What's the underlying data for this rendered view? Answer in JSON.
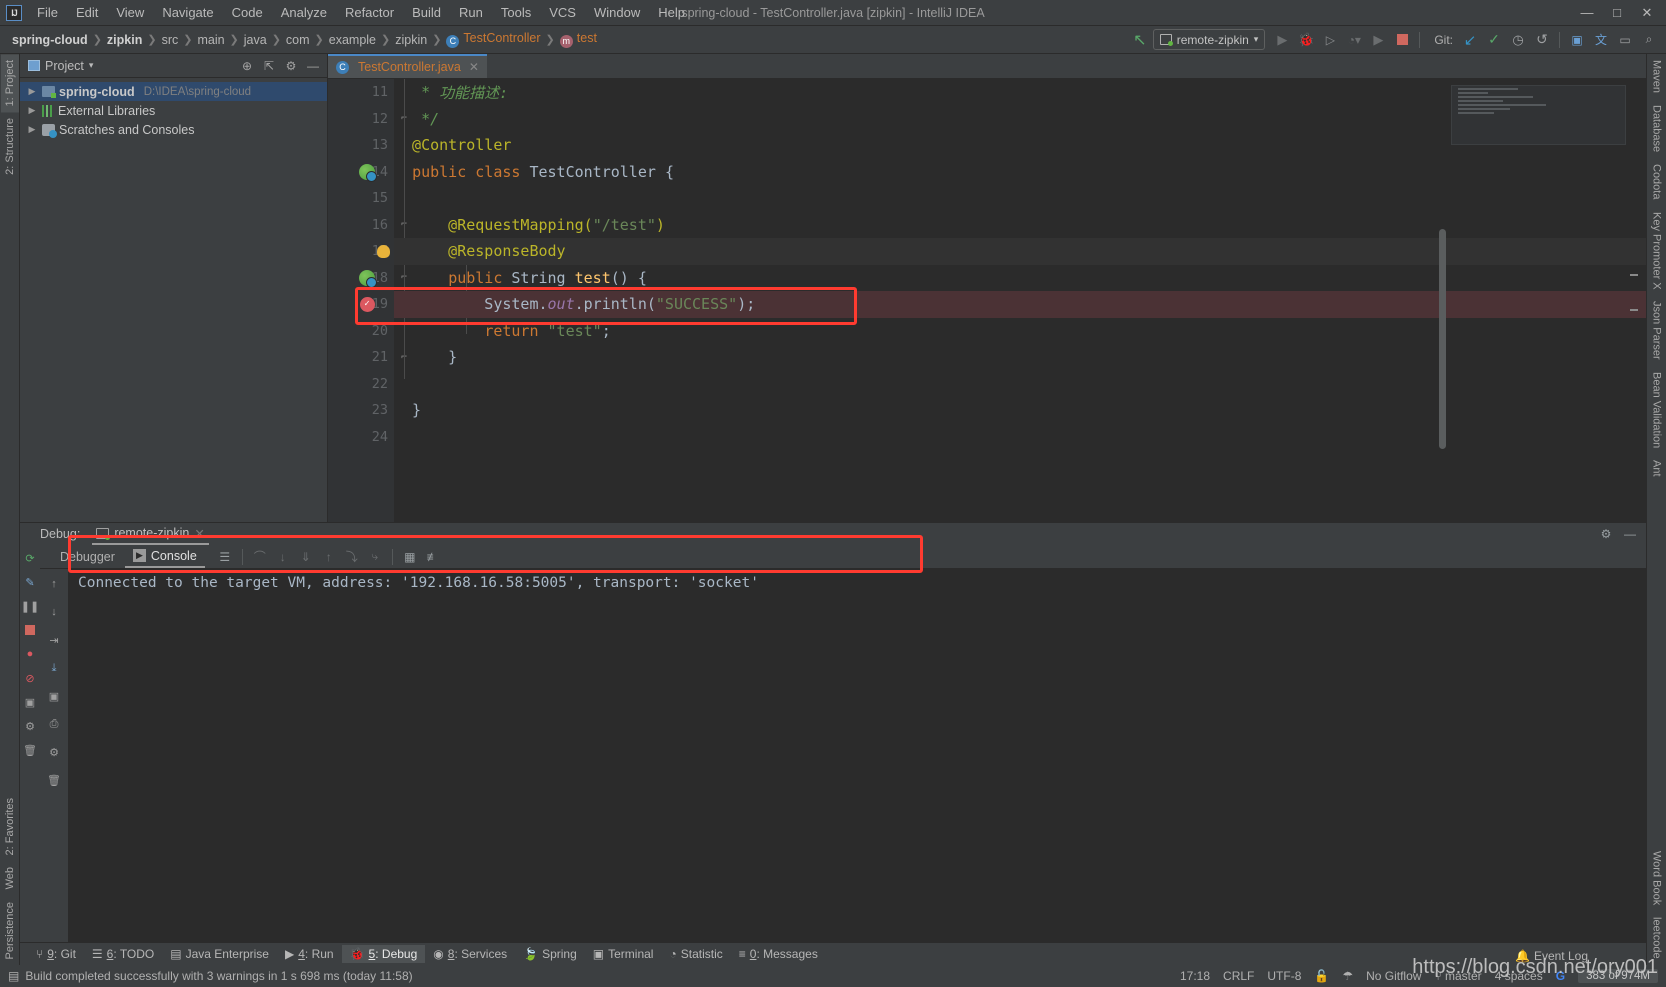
{
  "window": {
    "title": "spring-cloud - TestController.java [zipkin] - IntelliJ IDEA",
    "logo": "IJ",
    "minimize": "—",
    "maximize": "□",
    "close": "✕"
  },
  "menu": [
    "File",
    "Edit",
    "View",
    "Navigate",
    "Code",
    "Analyze",
    "Refactor",
    "Build",
    "Run",
    "Tools",
    "VCS",
    "Window",
    "Help"
  ],
  "breadcrumb": [
    {
      "label": "spring-cloud",
      "style": "bold"
    },
    {
      "label": "zipkin",
      "style": "bold"
    },
    {
      "label": "src",
      "style": "normal"
    },
    {
      "label": "main",
      "style": "normal"
    },
    {
      "label": "java",
      "style": "normal"
    },
    {
      "label": "com",
      "style": "normal"
    },
    {
      "label": "example",
      "style": "normal"
    },
    {
      "label": "zipkin",
      "style": "normal"
    },
    {
      "label": "TestController",
      "style": "class",
      "badge": "C"
    },
    {
      "label": "test",
      "style": "class",
      "badge": "m"
    }
  ],
  "toolbar": {
    "run_config": "remote-zipkin",
    "run_config_caret": "▾",
    "git_label": "Git:",
    "actions": [
      "back-arrow-icon",
      "run-icon",
      "debug-icon",
      "run-with-coverage-icon",
      "profile-icon",
      "attach-icon",
      "stop-icon"
    ],
    "git_actions": [
      "update-project-icon",
      "commit-icon",
      "history-icon",
      "rollback-icon"
    ],
    "right_actions": [
      "search-everywhere-icon",
      "translate-icon",
      "layout-icon",
      "settings-icon"
    ]
  },
  "project": {
    "header_title": "Project",
    "header_caret": "▾",
    "actions": [
      "locate-icon",
      "collapse-all-icon",
      "settings-icon",
      "hide-icon"
    ],
    "tree": [
      {
        "label": "spring-cloud",
        "path": "D:\\IDEA\\spring-cloud",
        "icon": "module-icon",
        "bold": true,
        "selected": true,
        "arrow": "▶"
      },
      {
        "label": "External Libraries",
        "path": "",
        "icon": "library-icon",
        "bold": false,
        "selected": false,
        "arrow": "▶"
      },
      {
        "label": "Scratches and Consoles",
        "path": "",
        "icon": "scratches-icon",
        "bold": false,
        "selected": false,
        "arrow": "▶"
      }
    ]
  },
  "editor": {
    "tab": {
      "label": "TestController.java",
      "badge": "C",
      "close": "✕"
    },
    "first_line_number": 11,
    "lines": [
      {
        "n": 11,
        "fold": "",
        "mark": "",
        "tokens": [
          {
            "t": "   * ",
            "c": "cmt"
          },
          {
            "t": "功能描述:",
            "c": "cmt"
          }
        ]
      },
      {
        "n": 12,
        "fold": "⌐",
        "mark": "",
        "tokens": [
          {
            "t": "   */",
            "c": "cmt"
          }
        ]
      },
      {
        "n": 13,
        "fold": "",
        "mark": "",
        "tokens": [
          {
            "t": "  @Controller",
            "c": "ann"
          }
        ]
      },
      {
        "n": 14,
        "fold": "",
        "mark": "run-to-cursor-icon",
        "tokens": [
          {
            "t": "  ",
            "c": "def"
          },
          {
            "t": "public class ",
            "c": "kw"
          },
          {
            "t": "TestController ",
            "c": "cls"
          },
          {
            "t": "{",
            "c": "def"
          }
        ]
      },
      {
        "n": 15,
        "fold": "",
        "mark": "",
        "tokens": []
      },
      {
        "n": 16,
        "fold": "⌐",
        "mark": "",
        "tokens": [
          {
            "t": "      @RequestMapping(",
            "c": "ann"
          },
          {
            "t": "\"/test\"",
            "c": "str"
          },
          {
            "t": ")",
            "c": "ann"
          }
        ]
      },
      {
        "n": 17,
        "fold": "⌐",
        "mark": "intention-bulb-icon",
        "tokens": [
          {
            "t": "      @ResponseBody",
            "c": "ann"
          }
        ]
      },
      {
        "n": 18,
        "fold": "⌐",
        "mark": "run-to-cursor-icon",
        "tokens": [
          {
            "t": "      ",
            "c": "def"
          },
          {
            "t": "public ",
            "c": "kw"
          },
          {
            "t": "String ",
            "c": "cls"
          },
          {
            "t": "test",
            "c": "fn"
          },
          {
            "t": "() {",
            "c": "def"
          }
        ]
      },
      {
        "n": 19,
        "fold": "",
        "mark": "breakpoint-icon",
        "highlight": "breakpoint",
        "tokens": [
          {
            "t": "          System.",
            "c": "cls"
          },
          {
            "t": "out",
            "c": "fld"
          },
          {
            "t": ".println(",
            "c": "cls"
          },
          {
            "t": "\"SUCCESS\"",
            "c": "str"
          },
          {
            "t": ");",
            "c": "cls"
          }
        ]
      },
      {
        "n": 20,
        "fold": "",
        "mark": "",
        "tokens": [
          {
            "t": "          ",
            "c": "def"
          },
          {
            "t": "return ",
            "c": "kw"
          },
          {
            "t": "\"test\"",
            "c": "str"
          },
          {
            "t": ";",
            "c": "def"
          }
        ]
      },
      {
        "n": 21,
        "fold": "⌐",
        "mark": "",
        "tokens": [
          {
            "t": "      }",
            "c": "def"
          }
        ]
      },
      {
        "n": 22,
        "fold": "",
        "mark": "",
        "tokens": []
      },
      {
        "n": 23,
        "fold": "",
        "mark": "",
        "tokens": [
          {
            "t": "  }",
            "c": "def"
          }
        ]
      },
      {
        "n": 24,
        "fold": "",
        "mark": "",
        "tokens": []
      }
    ]
  },
  "debug": {
    "panel_label": "Debug:",
    "session_tab": "remote-zipkin",
    "session_close": "✕",
    "header_actions": [
      "settings-icon",
      "hide-icon"
    ],
    "tabs": [
      {
        "label": "Debugger",
        "active": false,
        "icon": ""
      },
      {
        "label": "Console",
        "active": true,
        "icon": "▶"
      }
    ],
    "actions": [
      "layout-icon",
      "step-over-icon",
      "step-into-icon",
      "force-step-into-icon",
      "step-out-icon",
      "drop-frame-icon",
      "run-to-cursor-icon",
      "evaluate-icon",
      "mute-breakpoints-icon"
    ],
    "side_actions": [
      "rerun-icon",
      "edit-config-icon",
      "pause-icon",
      "stop-icon",
      "view-breakpoints-icon",
      "mute-breakpoints-icon",
      "settings-icon",
      "trash-icon"
    ],
    "console_output": "Connected to the target VM, address: '192.168.16.58:5005', transport: 'socket'",
    "console_gutter_actions": [
      "up-icon",
      "down-icon",
      "soft-wrap-icon",
      "scroll-end-icon",
      "print-icon",
      "camera-icon"
    ]
  },
  "left_tool_tabs": [
    {
      "label": "1: Project",
      "active": true
    },
    {
      "label": "2: Structure",
      "active": false
    },
    {
      "label": "2: Favorites",
      "active": false
    },
    {
      "label": "Web",
      "active": false
    },
    {
      "label": "Persistence",
      "active": false
    }
  ],
  "right_tool_tabs": [
    {
      "label": "Maven"
    },
    {
      "label": "Database"
    },
    {
      "label": "Codota"
    },
    {
      "label": "Key Promoter X"
    },
    {
      "label": "Json Parser"
    },
    {
      "label": "Bean Validation"
    },
    {
      "label": "Ant"
    },
    {
      "label": "Word Book"
    },
    {
      "label": "leetcode"
    }
  ],
  "tool_window_bar": [
    {
      "num": "9",
      "label": "Git",
      "icon": "git-icon",
      "active": false
    },
    {
      "num": "6",
      "label": "TODO",
      "icon": "todo-icon",
      "active": false
    },
    {
      "num": "",
      "label": "Java Enterprise",
      "icon": "java-enterprise-icon",
      "active": false
    },
    {
      "num": "4",
      "label": "Run",
      "icon": "run-icon",
      "active": false
    },
    {
      "num": "5",
      "label": "Debug",
      "icon": "debug-icon",
      "active": true
    },
    {
      "num": "8",
      "label": "Services",
      "icon": "services-icon",
      "active": false
    },
    {
      "num": "",
      "label": "Spring",
      "icon": "spring-icon",
      "active": false
    },
    {
      "num": "",
      "label": "Terminal",
      "icon": "terminal-icon",
      "active": false
    },
    {
      "num": "",
      "label": "Statistic",
      "icon": "statistic-icon",
      "active": false
    },
    {
      "num": "0",
      "label": "Messages",
      "icon": "messages-icon",
      "active": false
    }
  ],
  "status_bar": {
    "message": "Build completed successfully with 3 warnings in 1 s 698 ms (today 11:58)",
    "message_icon": "build-icon",
    "time": "17:18",
    "line_separator": "CRLF",
    "encoding": "UTF-8",
    "lock_icon": "unlock-icon",
    "inspection_icon": "hector-icon",
    "gitflow": "No Gitflow",
    "branch": "master",
    "branch_icon": "branch-icon",
    "indent": "4 spaces",
    "google_icon": "google-icon",
    "memory": "383 of 974M",
    "event_log": "Event Log",
    "event_log_icon": "notification-icon"
  },
  "watermark": "https://blog.csdn.net/ory001",
  "colors": {
    "accent_blue": "#4a88c7",
    "annotation_red": "#ff3b30",
    "breakpoint_red": "#db5860",
    "editor_bg": "#2b2b2b",
    "panel_bg": "#3c3f41",
    "string_green": "#6a8759",
    "keyword_orange": "#cc7832",
    "annotation_yellow": "#bbb529",
    "comment_green": "#629755"
  }
}
